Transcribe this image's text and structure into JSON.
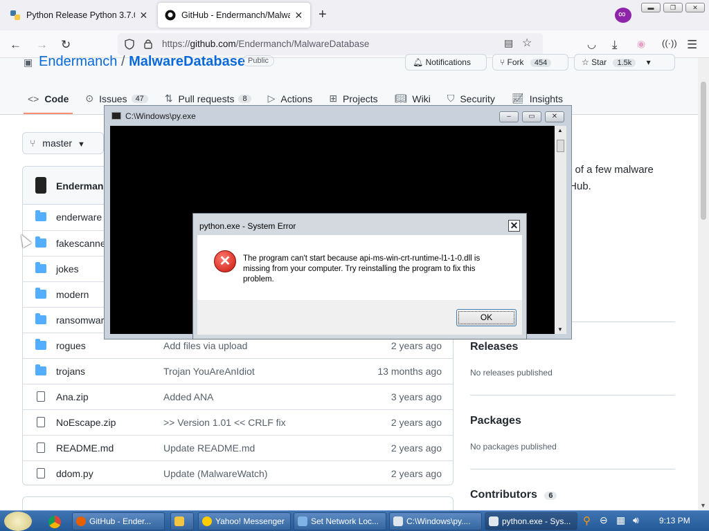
{
  "browser": {
    "tabs": [
      {
        "title": "Python Release Python 3.7.0 | Py",
        "favicon": "python-icon"
      },
      {
        "title": "GitHub - Endermanch/MalwareDatabase",
        "favicon": "github-icon"
      }
    ],
    "new_tab": "+",
    "url_prefix": "https://",
    "url_host": "github.com",
    "url_path": "/Endermanch/MalwareDatabase"
  },
  "repo": {
    "owner": "Endermanch",
    "separator": "/",
    "name": "MalwareDatabase",
    "visibility": "Public",
    "notifications_label": "Notifications",
    "fork_label": "Fork",
    "fork_count": "454",
    "star_label": "Star",
    "star_count": "1.5k"
  },
  "repo_tabs": [
    {
      "label": "Code",
      "count": null
    },
    {
      "label": "Issues",
      "count": "47"
    },
    {
      "label": "Pull requests",
      "count": "8"
    },
    {
      "label": "Actions",
      "count": null
    },
    {
      "label": "Projects",
      "count": null
    },
    {
      "label": "Wiki",
      "count": null
    },
    {
      "label": "Security",
      "count": null
    },
    {
      "label": "Insights",
      "count": null
    }
  ],
  "branch": {
    "label": "master"
  },
  "commit": {
    "user": "Endermanc"
  },
  "files": [
    {
      "name": "enderware",
      "type": "dir",
      "message": "",
      "age": ""
    },
    {
      "name": "fakescanner",
      "type": "dir",
      "message": "",
      "age": ""
    },
    {
      "name": "jokes",
      "type": "dir",
      "message": "",
      "age": ""
    },
    {
      "name": "modern",
      "type": "dir",
      "message": "",
      "age": ""
    },
    {
      "name": "ransomwar",
      "type": "dir",
      "message": "",
      "age": ""
    },
    {
      "name": "rogues",
      "type": "dir",
      "message": "Add files via upload",
      "age": "2 years ago"
    },
    {
      "name": "trojans",
      "type": "dir",
      "message": "Trojan YouAreAnIdiot",
      "age": "13 months ago"
    },
    {
      "name": "Ana.zip",
      "type": "file",
      "message": "Added ANA",
      "age": "3 years ago"
    },
    {
      "name": "NoEscape.zip",
      "type": "file",
      "message": ">> Version 1.01 << CRLF fix",
      "age": "2 years ago"
    },
    {
      "name": "README.md",
      "type": "file",
      "message": "Update README.md",
      "age": "2 years ago"
    },
    {
      "name": "ddom.py",
      "type": "file",
      "message": "Update (MalwareWatch)",
      "age": "2 years ago"
    }
  ],
  "sidebar": {
    "about_line1": "e of a few malware",
    "about_line2": "tHub.",
    "releases_title": "Releases",
    "releases_text": "No releases published",
    "packages_title": "Packages",
    "packages_text": "No packages published",
    "contributors_title": "Contributors",
    "contributors_count": "6"
  },
  "console": {
    "title": "C:\\Windows\\py.exe",
    "minimize": "–",
    "maximize": "▭",
    "close": "✕"
  },
  "dialog": {
    "title": "python.exe - System Error",
    "close": "✕",
    "message": "The program can't start because api-ms-win-crt-runtime-l1-1-0.dll is missing from your computer. Try reinstalling the program to fix this problem.",
    "ok": "OK",
    "icon": "error-icon"
  },
  "taskbar": {
    "items": [
      {
        "label": "GitHub - Ender...",
        "icon": "firefox-icon"
      },
      {
        "label": "",
        "icon": "folder-icon"
      },
      {
        "label": "Yahoo! Messenger",
        "icon": "yahoo-icon"
      },
      {
        "label": "Set Network Loc...",
        "icon": "network-icon"
      },
      {
        "label": "C:\\Windows\\py....",
        "icon": "console-icon"
      },
      {
        "label": "python.exe - Sys...",
        "icon": "console-icon"
      }
    ],
    "clock": "9:13 PM"
  },
  "colors": {
    "github_link": "#0969da",
    "folder": "#54aeff",
    "tab_underline": "#fd8c73",
    "error_red": "#c8140c",
    "taskbar": "#2f64a3"
  }
}
